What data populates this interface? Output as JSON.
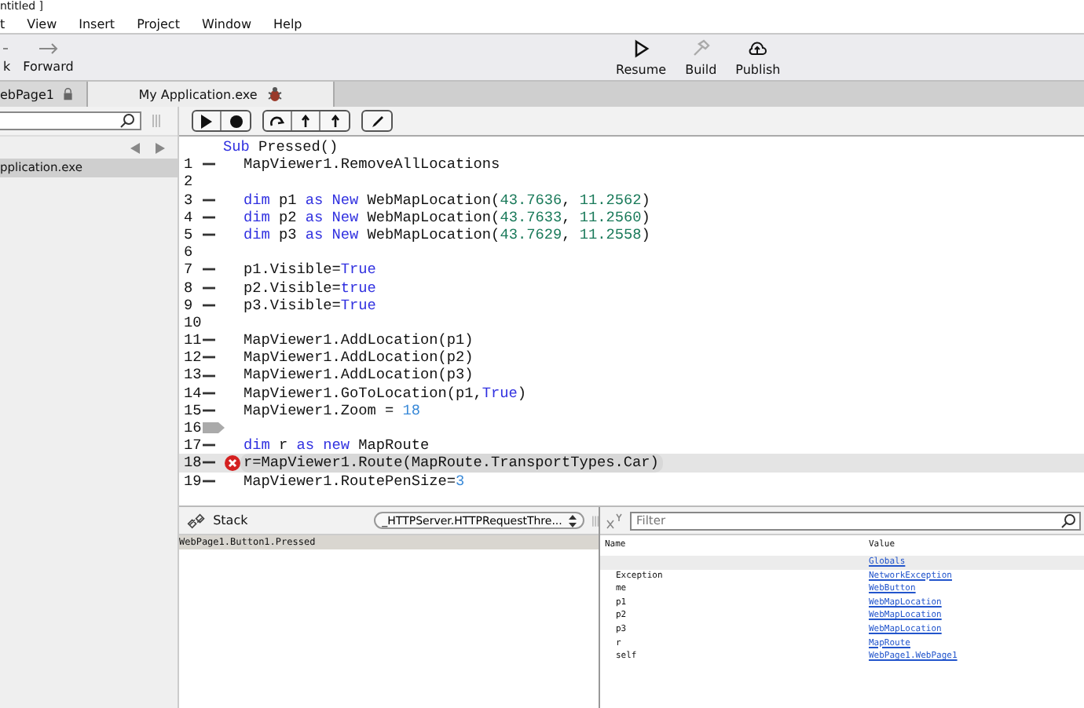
{
  "window": {
    "title": "ntitled ]"
  },
  "menu": [
    "t",
    "View",
    "Insert",
    "Project",
    "Window",
    "Help"
  ],
  "nav_buttons": [
    {
      "label": "k",
      "kind": "back"
    },
    {
      "label": "Forward",
      "kind": "forward"
    }
  ],
  "toolbar": [
    {
      "label": "Resume",
      "kind": "resume",
      "disabled": false
    },
    {
      "label": "Build",
      "kind": "build",
      "disabled": true
    },
    {
      "label": "Publish",
      "kind": "publish",
      "disabled": false
    }
  ],
  "tabs": [
    {
      "label": "ebPage1",
      "kind": "lock",
      "selected": false
    },
    {
      "label": "My Application.exe",
      "kind": "bug",
      "selected": true
    }
  ],
  "debug_buttons": [
    [
      {
        "kind": "run"
      },
      {
        "kind": "stop"
      }
    ],
    [
      {
        "kind": "step-over"
      },
      {
        "kind": "step-in"
      },
      {
        "kind": "step-out"
      }
    ],
    [
      {
        "kind": "edit"
      }
    ]
  ],
  "navigator": {
    "items": [
      {
        "label": "pplication.exe",
        "selected": true
      }
    ]
  },
  "code": {
    "header": [
      {
        "t": "Sub",
        "kind": "kw"
      },
      {
        "t": " Pressed()",
        "kind": "plain"
      }
    ],
    "lines": [
      {
        "n": "1",
        "kind": "dash",
        "error": false,
        "seg": [
          {
            "t": "MapViewer1.RemoveAllLocations",
            "kind": "plain"
          }
        ]
      },
      {
        "n": "2",
        "kind": "plain",
        "error": false
      },
      {
        "n": "3",
        "kind": "dash",
        "error": false,
        "seg": [
          {
            "t": "dim",
            "kind": "kw"
          },
          {
            "t": " p1 ",
            "kind": "plain"
          },
          {
            "t": "as New",
            "kind": "kw"
          },
          {
            "t": " WebMapLocation(",
            "kind": "plain"
          },
          {
            "t": "43.7636",
            "kind": "num"
          },
          {
            "t": ", ",
            "kind": "plain"
          },
          {
            "t": "11.2562",
            "kind": "num"
          },
          {
            "t": ")",
            "kind": "plain"
          }
        ]
      },
      {
        "n": "4",
        "kind": "dash",
        "error": false,
        "seg": [
          {
            "t": "dim",
            "kind": "kw"
          },
          {
            "t": " p2 ",
            "kind": "plain"
          },
          {
            "t": "as New",
            "kind": "kw"
          },
          {
            "t": " WebMapLocation(",
            "kind": "plain"
          },
          {
            "t": "43.7633",
            "kind": "num"
          },
          {
            "t": ", ",
            "kind": "plain"
          },
          {
            "t": "11.2560",
            "kind": "num"
          },
          {
            "t": ")",
            "kind": "plain"
          }
        ]
      },
      {
        "n": "5",
        "kind": "dash",
        "error": false,
        "seg": [
          {
            "t": "dim",
            "kind": "kw"
          },
          {
            "t": " p3 ",
            "kind": "plain"
          },
          {
            "t": "as New",
            "kind": "kw"
          },
          {
            "t": " WebMapLocation(",
            "kind": "plain"
          },
          {
            "t": "43.7629",
            "kind": "num"
          },
          {
            "t": ", ",
            "kind": "plain"
          },
          {
            "t": "11.2558",
            "kind": "num"
          },
          {
            "t": ")",
            "kind": "plain"
          }
        ]
      },
      {
        "n": "6",
        "kind": "plain",
        "error": false
      },
      {
        "n": "7",
        "kind": "dash",
        "error": false,
        "seg": [
          {
            "t": "p1.Visible=",
            "kind": "plain"
          },
          {
            "t": "True",
            "kind": "kw"
          }
        ]
      },
      {
        "n": "8",
        "kind": "dash",
        "error": false,
        "seg": [
          {
            "t": "p2.Visible=",
            "kind": "plain"
          },
          {
            "t": "true",
            "kind": "kw"
          }
        ]
      },
      {
        "n": "9",
        "kind": "dash",
        "error": false,
        "seg": [
          {
            "t": "p3.Visible=",
            "kind": "plain"
          },
          {
            "t": "True",
            "kind": "kw"
          }
        ]
      },
      {
        "n": "10",
        "kind": "plain",
        "error": false
      },
      {
        "n": "11",
        "kind": "dash",
        "error": false,
        "seg": [
          {
            "t": "MapViewer1.AddLocation(p1)",
            "kind": "plain"
          }
        ]
      },
      {
        "n": "12",
        "kind": "dash",
        "error": false,
        "seg": [
          {
            "t": "MapViewer1.AddLocation(p2)",
            "kind": "plain"
          }
        ]
      },
      {
        "n": "13",
        "kind": "dash",
        "error": false,
        "seg": [
          {
            "t": "MapViewer1.AddLocation(p3)",
            "kind": "plain"
          }
        ]
      },
      {
        "n": "14",
        "kind": "dash",
        "error": false,
        "seg": [
          {
            "t": "MapViewer1.GoToLocation(p1,",
            "kind": "plain"
          },
          {
            "t": "True",
            "kind": "kw"
          },
          {
            "t": ")",
            "kind": "plain"
          }
        ]
      },
      {
        "n": "15",
        "kind": "dash",
        "error": false,
        "seg": [
          {
            "t": "MapViewer1.Zoom = ",
            "kind": "plain"
          },
          {
            "t": "18",
            "kind": "num2"
          }
        ]
      },
      {
        "n": "16",
        "kind": "arrow",
        "error": false
      },
      {
        "n": "17",
        "kind": "dash",
        "error": false,
        "seg": [
          {
            "t": "dim",
            "kind": "kw"
          },
          {
            "t": " r ",
            "kind": "plain"
          },
          {
            "t": "as new",
            "kind": "kw"
          },
          {
            "t": " MapRoute",
            "kind": "plain"
          }
        ]
      },
      {
        "n": "18",
        "kind": "dash",
        "error": true,
        "seg": [
          {
            "t": "r=MapViewer1.Route(MapRoute.TransportTypes.Car)",
            "kind": "plain"
          }
        ]
      },
      {
        "n": "19",
        "kind": "dash",
        "error": false,
        "seg": [
          {
            "t": "MapViewer1.RoutePenSize=",
            "kind": "plain"
          },
          {
            "t": "3",
            "kind": "num2"
          }
        ]
      }
    ]
  },
  "stack": {
    "title": "Stack",
    "thread": "_HTTPServer.HTTPRequestThre...",
    "frames": [
      {
        "label": "WebPage1.Button1.Pressed",
        "selected": true
      }
    ]
  },
  "variables": {
    "filter": {
      "placeholder": "Filter"
    },
    "columns": [
      "Name",
      "Value"
    ],
    "rows": [
      {
        "value": "Globals",
        "selected": true
      },
      {
        "name": "Exception",
        "value": "NetworkException",
        "selected": false
      },
      {
        "name": "me",
        "value": "WebButton",
        "selected": false
      },
      {
        "name": "p1",
        "value": "WebMapLocation",
        "selected": false
      },
      {
        "name": "p2",
        "value": "WebMapLocation",
        "selected": false
      },
      {
        "name": "p3",
        "value": "WebMapLocation",
        "selected": false
      },
      {
        "name": "r",
        "value": "MapRoute",
        "selected": false
      },
      {
        "name": "self",
        "value": "WebPage1.WebPage1",
        "selected": false
      }
    ]
  }
}
